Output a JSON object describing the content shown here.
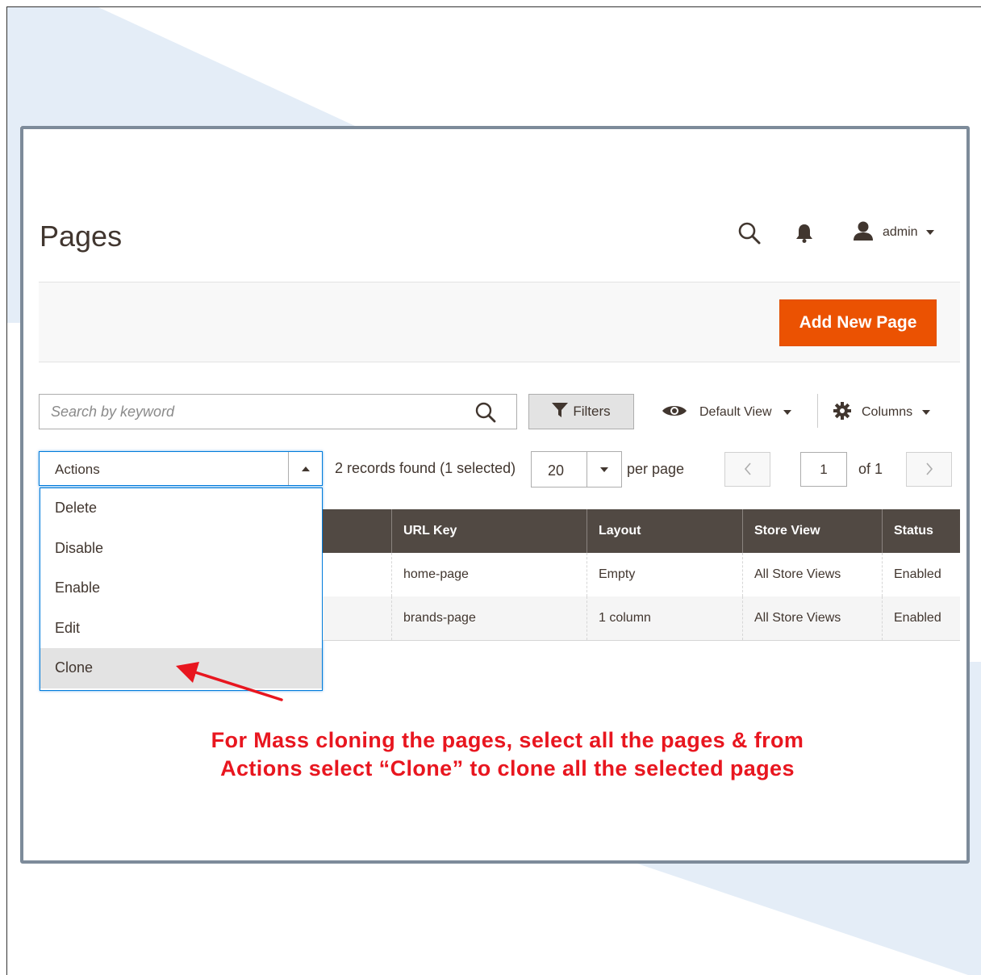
{
  "header": {
    "page_title": "Pages",
    "search_icon": "search-icon",
    "notification_icon": "bell-icon",
    "user_label": "admin"
  },
  "toolbar": {
    "add_button_label": "Add New Page",
    "accent_color": "#eb5202"
  },
  "grid_controls": {
    "search_placeholder": "Search by keyword",
    "filters_label": "Filters",
    "view_label": "Default View",
    "columns_label": "Columns",
    "actions_label": "Actions",
    "records_text": "2 records found (1 selected)",
    "per_page_value": "20",
    "per_page_label": "per page",
    "current_page": "1",
    "page_total_label": "of 1"
  },
  "actions_menu": {
    "items": [
      "Delete",
      "Disable",
      "Enable",
      "Edit",
      "Clone"
    ],
    "highlighted": "Clone"
  },
  "grid": {
    "columns": [
      "URL Key",
      "Layout",
      "Store View",
      "Status"
    ],
    "rows": [
      [
        "home-page",
        "Empty",
        "All Store Views",
        "Enabled"
      ],
      [
        "brands-page",
        "1 column",
        "All Store Views",
        "Enabled"
      ]
    ]
  },
  "annotation": {
    "line1": "For Mass cloning the pages, select all the pages & from",
    "line2": "Actions select “Clone” to clone all the selected pages",
    "color": "#e8161f"
  }
}
